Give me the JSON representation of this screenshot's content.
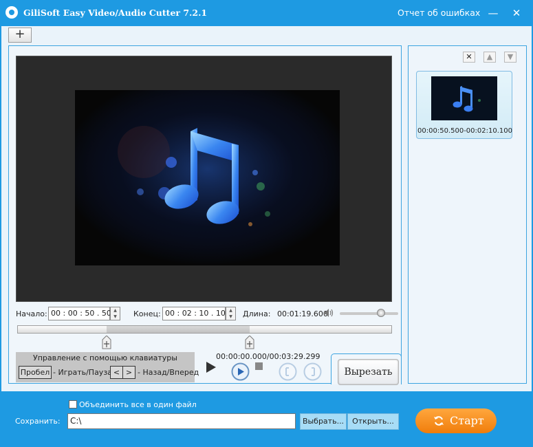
{
  "window": {
    "title": "GiliSoft Easy Video/Audio Cutter 7.2.1",
    "report_link": "Отчет об ошибках",
    "minimize_glyph": "—",
    "close_glyph": "✕"
  },
  "toolbar": {
    "add_glyph": "+"
  },
  "clip_list": {
    "remove_glyph": "✕",
    "up_glyph": "▲",
    "down_glyph": "▼",
    "items": [
      {
        "label": "00:00:50.500-00:02:10.100"
      }
    ]
  },
  "trim": {
    "start_label": "Начало:",
    "start_value": "00 : 00 : 50 . 500",
    "end_label": "Конец:",
    "end_value": "00 : 02 : 10 . 100",
    "length_label": "Длина:",
    "length_value": "00:01:19.600",
    "volume_level": 0.7
  },
  "keyboard": {
    "title": "Управление с помощью клавиатуры",
    "space_key": "Пробел",
    "play_pause": "- Играть/Пауза",
    "left_key": "<",
    "right_key": ">",
    "back_forward": "- Назад/Вперед"
  },
  "playback": {
    "position": "00:00:00.000/00:03:29.299"
  },
  "cut_button": "Вырезать",
  "output": {
    "merge_label": "Объединить все в один файл",
    "merge_checked": false,
    "save_label": "Сохранить:",
    "path": "C:\\",
    "browse_label": "Выбрать...",
    "open_label": "Открыть...",
    "start_label": "Старт"
  },
  "colors": {
    "accent": "#1e9ae2",
    "start_button": "#f5901f"
  }
}
